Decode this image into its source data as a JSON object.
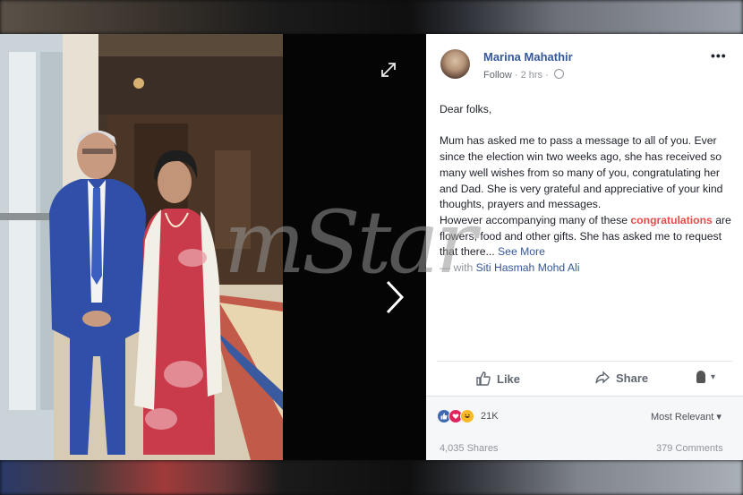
{
  "post": {
    "author": "Marina Mahathir",
    "follow_label": "Follow",
    "time": "2 hrs",
    "meta_separator": "·",
    "greeting": "Dear folks,",
    "body_1": "Mum has asked me to pass a message to all of you. Ever since the election win two weeks ago, she has received so many well wishes from so many of you, congratulating her and Dad. She is very grateful and appreciative of your kind thoughts, prayers and messages.",
    "body_2_a": "However accompanying many of these",
    "body_2_hl": "congratulations",
    "body_2_b": "are flowers, food and other gifts. She has asked me to request that there...",
    "see_more": "See More",
    "tag_prefix": "— with",
    "tag_name": "Siti Hasmah Mohd Ali",
    "more_options": "•••"
  },
  "actions": {
    "like_label": "Like",
    "share_label": "Share",
    "viewer_caret": "▾"
  },
  "reactions": {
    "count": "21K",
    "sort_label": "Most Relevant ▾",
    "shares": "4,035 Shares",
    "comments": "379 Comments",
    "icons": [
      "like-icon",
      "love-icon",
      "haha-icon"
    ]
  },
  "watermark": "mStar",
  "colors": {
    "link": "#365899",
    "highlight": "#e02c2c",
    "muted": "#90949c"
  }
}
